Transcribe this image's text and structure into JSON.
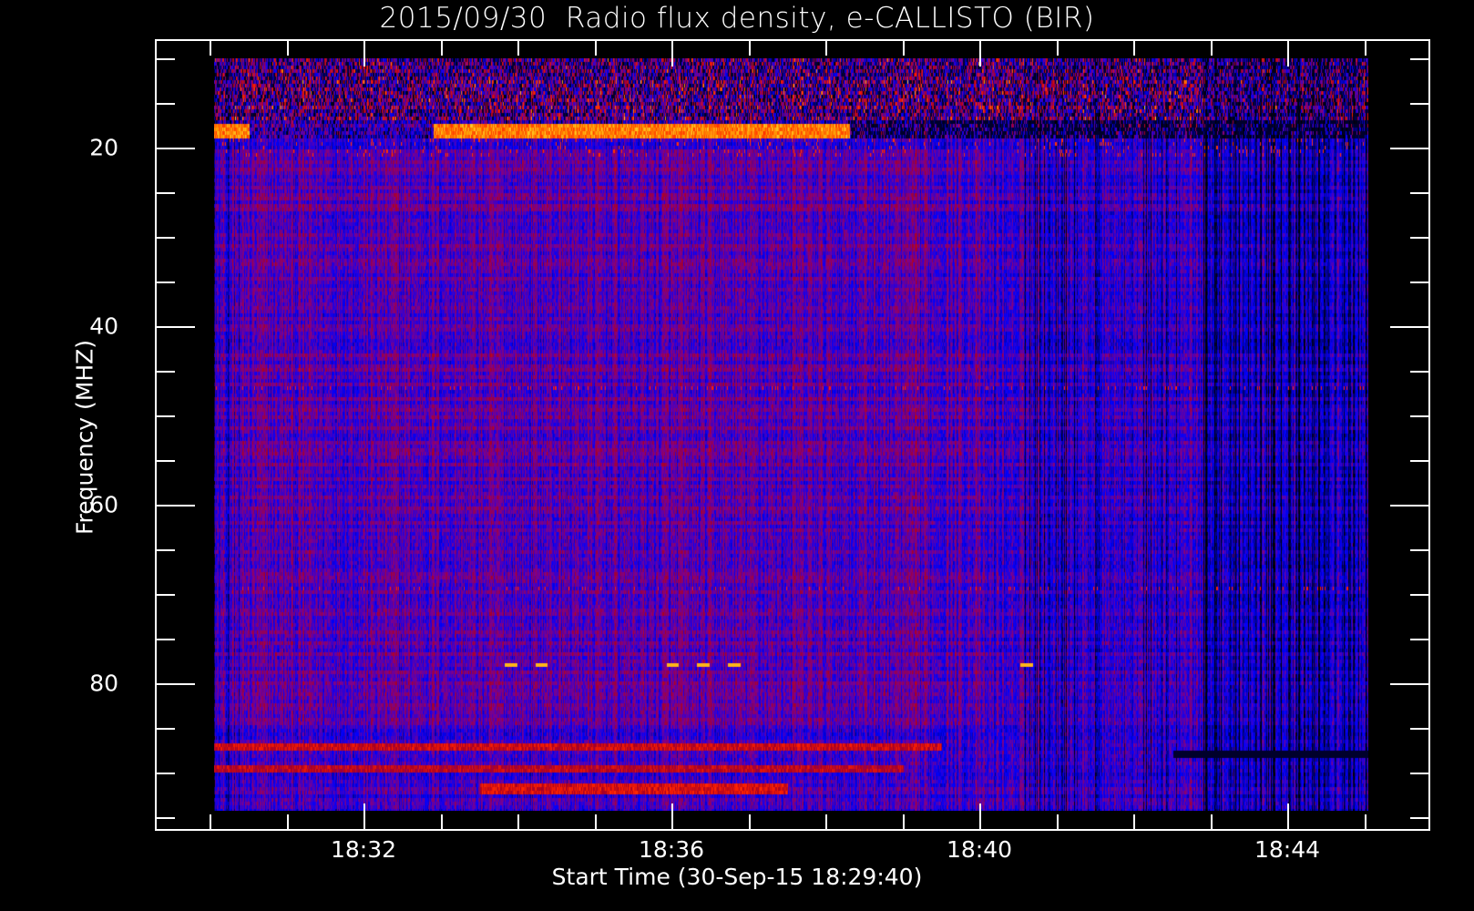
{
  "chart_data": {
    "type": "heatmap",
    "title": "2015/09/30  Radio flux density, e-CALLISTO (BIR)",
    "xlabel": "Start Time (30-Sep-15 18:29:40)",
    "ylabel": "Frequency (MHZ)",
    "x_unit": "minutes after 18:30 UT",
    "xlim": [
      -0.7,
      15.8
    ],
    "ylim": [
      96.3,
      7.9
    ],
    "data_extent": {
      "t_start": 0.05,
      "t_end": 15.05,
      "f_min": 10,
      "f_max": 94.2
    },
    "x_major_ticks": [
      {
        "t": 2,
        "label": "18:32"
      },
      {
        "t": 6,
        "label": "18:36"
      },
      {
        "t": 10,
        "label": "18:40"
      },
      {
        "t": 14,
        "label": "18:44"
      }
    ],
    "x_minor_step": 1,
    "y_major_ticks": [
      {
        "f": 20,
        "label": "20"
      },
      {
        "f": 40,
        "label": "40"
      },
      {
        "f": 60,
        "label": "60"
      },
      {
        "f": 80,
        "label": "80"
      }
    ],
    "y_minor_step": 5,
    "colormap": [
      "#000000",
      "#0000ff",
      "#80008a",
      "#aa0020",
      "#ff2000",
      "#ff9600",
      "#ffff50"
    ],
    "features": {
      "bright_bands": [
        {
          "f": 18,
          "t": [
            2.9,
            8.3
          ],
          "level": 0.95
        },
        {
          "f": 18,
          "t": [
            0.0,
            0.5
          ],
          "level": 0.95
        },
        {
          "f": 87.2,
          "t": [
            0.0,
            9.5
          ],
          "level": 0.78
        },
        {
          "f": 89.5,
          "t": [
            0.0,
            9.0
          ],
          "level": 0.75
        },
        {
          "f": 91.8,
          "t": [
            3.5,
            7.5
          ],
          "level": 0.8
        }
      ],
      "spots_78MHz": [
        3.9,
        4.3,
        6.0,
        6.4,
        6.8,
        10.6
      ],
      "quiet_region_start": 12.9
    },
    "grid": false,
    "legend": "none"
  }
}
